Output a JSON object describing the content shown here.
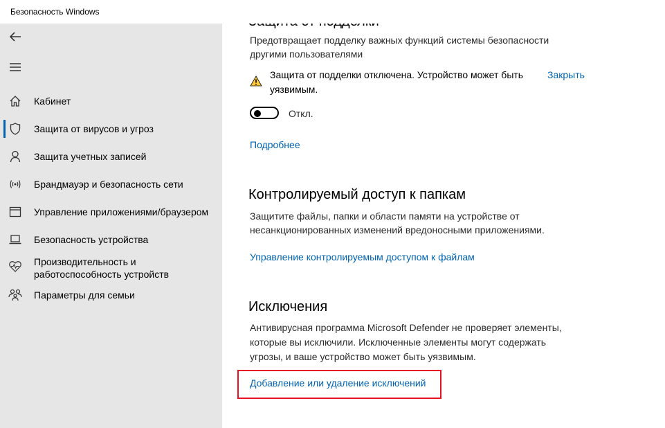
{
  "window": {
    "title": "Безопасность Windows"
  },
  "sidebar": {
    "items": [
      {
        "label": "Кабинет",
        "icon": "home-icon"
      },
      {
        "label": "Защита от вирусов и угроз",
        "icon": "shield-icon"
      },
      {
        "label": "Защита учетных записей",
        "icon": "person-icon"
      },
      {
        "label": "Брандмауэр и безопасность сети",
        "icon": "wifi-antenna-icon"
      },
      {
        "label": "Управление приложениями/браузером",
        "icon": "app-window-icon"
      },
      {
        "label": "Безопасность устройства",
        "icon": "laptop-icon"
      },
      {
        "label": "Производительность и работоспособность устройств",
        "line1": "Производительность и",
        "line2": "работоспособность устройств",
        "icon": "heart-pulse-icon"
      },
      {
        "label": "Параметры для семьи",
        "icon": "family-icon"
      }
    ],
    "active_index": 1
  },
  "tamper": {
    "heading_cut": "Защита от подделки",
    "description_line1": "Предотвращает подделку важных функций системы безопасности",
    "description_line2": "другими пользователями",
    "warning_line1": "Защита от подделки отключена. Устройство может быть",
    "warning_line2": "уязвимым.",
    "dismiss_label": "Закрыть",
    "toggle_state": "Откл.",
    "more_link": "Подробнее"
  },
  "folder_access": {
    "heading": "Контролируемый доступ к папкам",
    "description_line1": "Защитите файлы, папки и области памяти на устройстве от",
    "description_line2": "несанкционированных изменений вредоносными приложениями.",
    "manage_link": "Управление контролируемым доступом к файлам"
  },
  "exclusions": {
    "heading": "Исключения",
    "description_line1": "Антивирусная программа Microsoft Defender не проверяет элементы,",
    "description_line2": "которые вы исключили. Исключенные элементы могут содержать",
    "description_line3": "угрозы, и ваше устройство может быть уязвимым.",
    "add_remove_link": "Добавление или удаление исключений"
  },
  "colors": {
    "accent": "#0063b1",
    "sidebar_bg": "#e6e6e6",
    "warning": "#ffc83d",
    "highlight": "#e81123"
  }
}
